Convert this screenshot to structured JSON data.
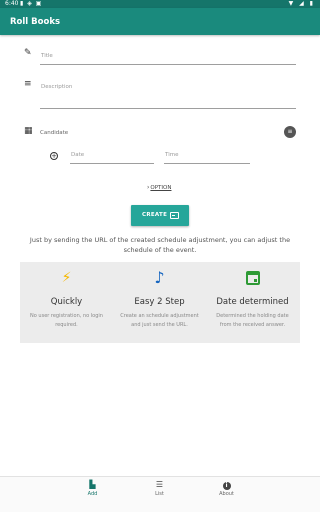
{
  "status_bar": {
    "time": "6:40",
    "left_icons": "▮ ◈ ▣",
    "right_icons": "▼ ◢ ▮"
  },
  "app_bar": {
    "title": "Roll Books",
    "color": "#1a8a7d"
  },
  "form": {
    "title_placeholder": "Title",
    "description_placeholder": "Description",
    "candidate_label": "Candidate",
    "date_placeholder": "Date",
    "time_placeholder": "Time",
    "option_label": "OPTION"
  },
  "create_button": {
    "label": "CREATE"
  },
  "description_text": "Just by sending the URL of the created schedule adjustment, you can adjust the schedule of the event.",
  "features": [
    {
      "icon": "lightning-icon",
      "title": "Quickly",
      "desc": "No user registration, no login required.",
      "color": "#f5b800"
    },
    {
      "icon": "music-note-icon",
      "title": "Easy 2 Step",
      "desc": "Create an schedule adjustment and just send the URL.",
      "color": "#1565c0"
    },
    {
      "icon": "calendar-icon",
      "title": "Date determined",
      "desc": "Determined the holding date from the received answer.",
      "color": "#2e9a35"
    }
  ],
  "bottom_nav": [
    {
      "label": "Add",
      "icon": "add-document-icon",
      "active": true
    },
    {
      "label": "List",
      "icon": "list-icon",
      "active": false
    },
    {
      "label": "About",
      "icon": "info-icon",
      "active": false
    }
  ]
}
